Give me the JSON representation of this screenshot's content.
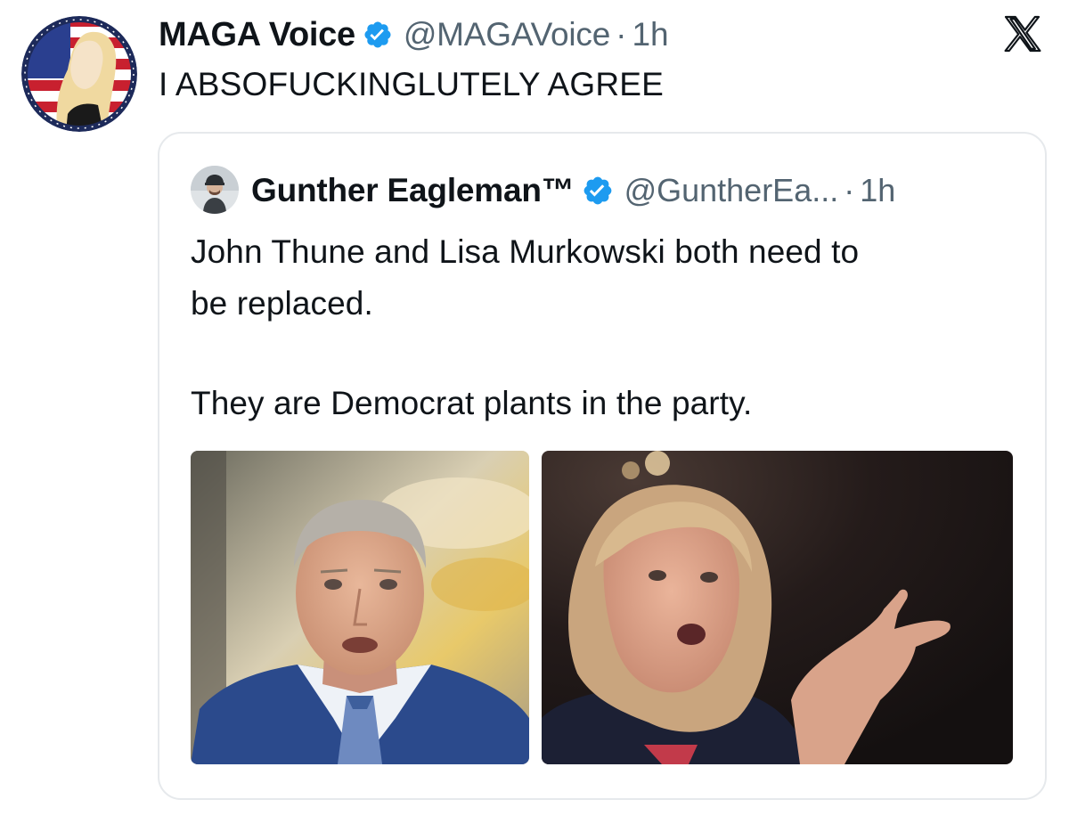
{
  "tweet": {
    "display_name": "MAGA Voice",
    "handle": "@MAGAVoice",
    "separator": "·",
    "time": "1h",
    "text": "I ABSOFUCKINGLUTELY AGREE",
    "avatar_icon": "maga-voice-avatar",
    "verified_icon": "verified-badge-icon"
  },
  "platform": {
    "logo_icon": "x-logo-icon"
  },
  "quoted_tweet": {
    "display_name": "Gunther Eagleman™",
    "handle": "@GuntherEa...",
    "separator": "·",
    "time": "1h",
    "text_line_1": "John Thune and Lisa Murkowski both need to",
    "text_line_2": "be replaced.",
    "text_line_3": "They are Democrat plants in the party.",
    "avatar_icon": "gunther-eagleman-avatar",
    "verified_icon": "verified-badge-icon",
    "images": [
      {
        "alt": "photo-john-thune"
      },
      {
        "alt": "photo-lisa-murkowski"
      }
    ]
  },
  "colors": {
    "text_primary": "#0f1419",
    "text_secondary": "#536471",
    "verified_blue": "#1d9bf0",
    "card_border": "#e6e9ec"
  }
}
